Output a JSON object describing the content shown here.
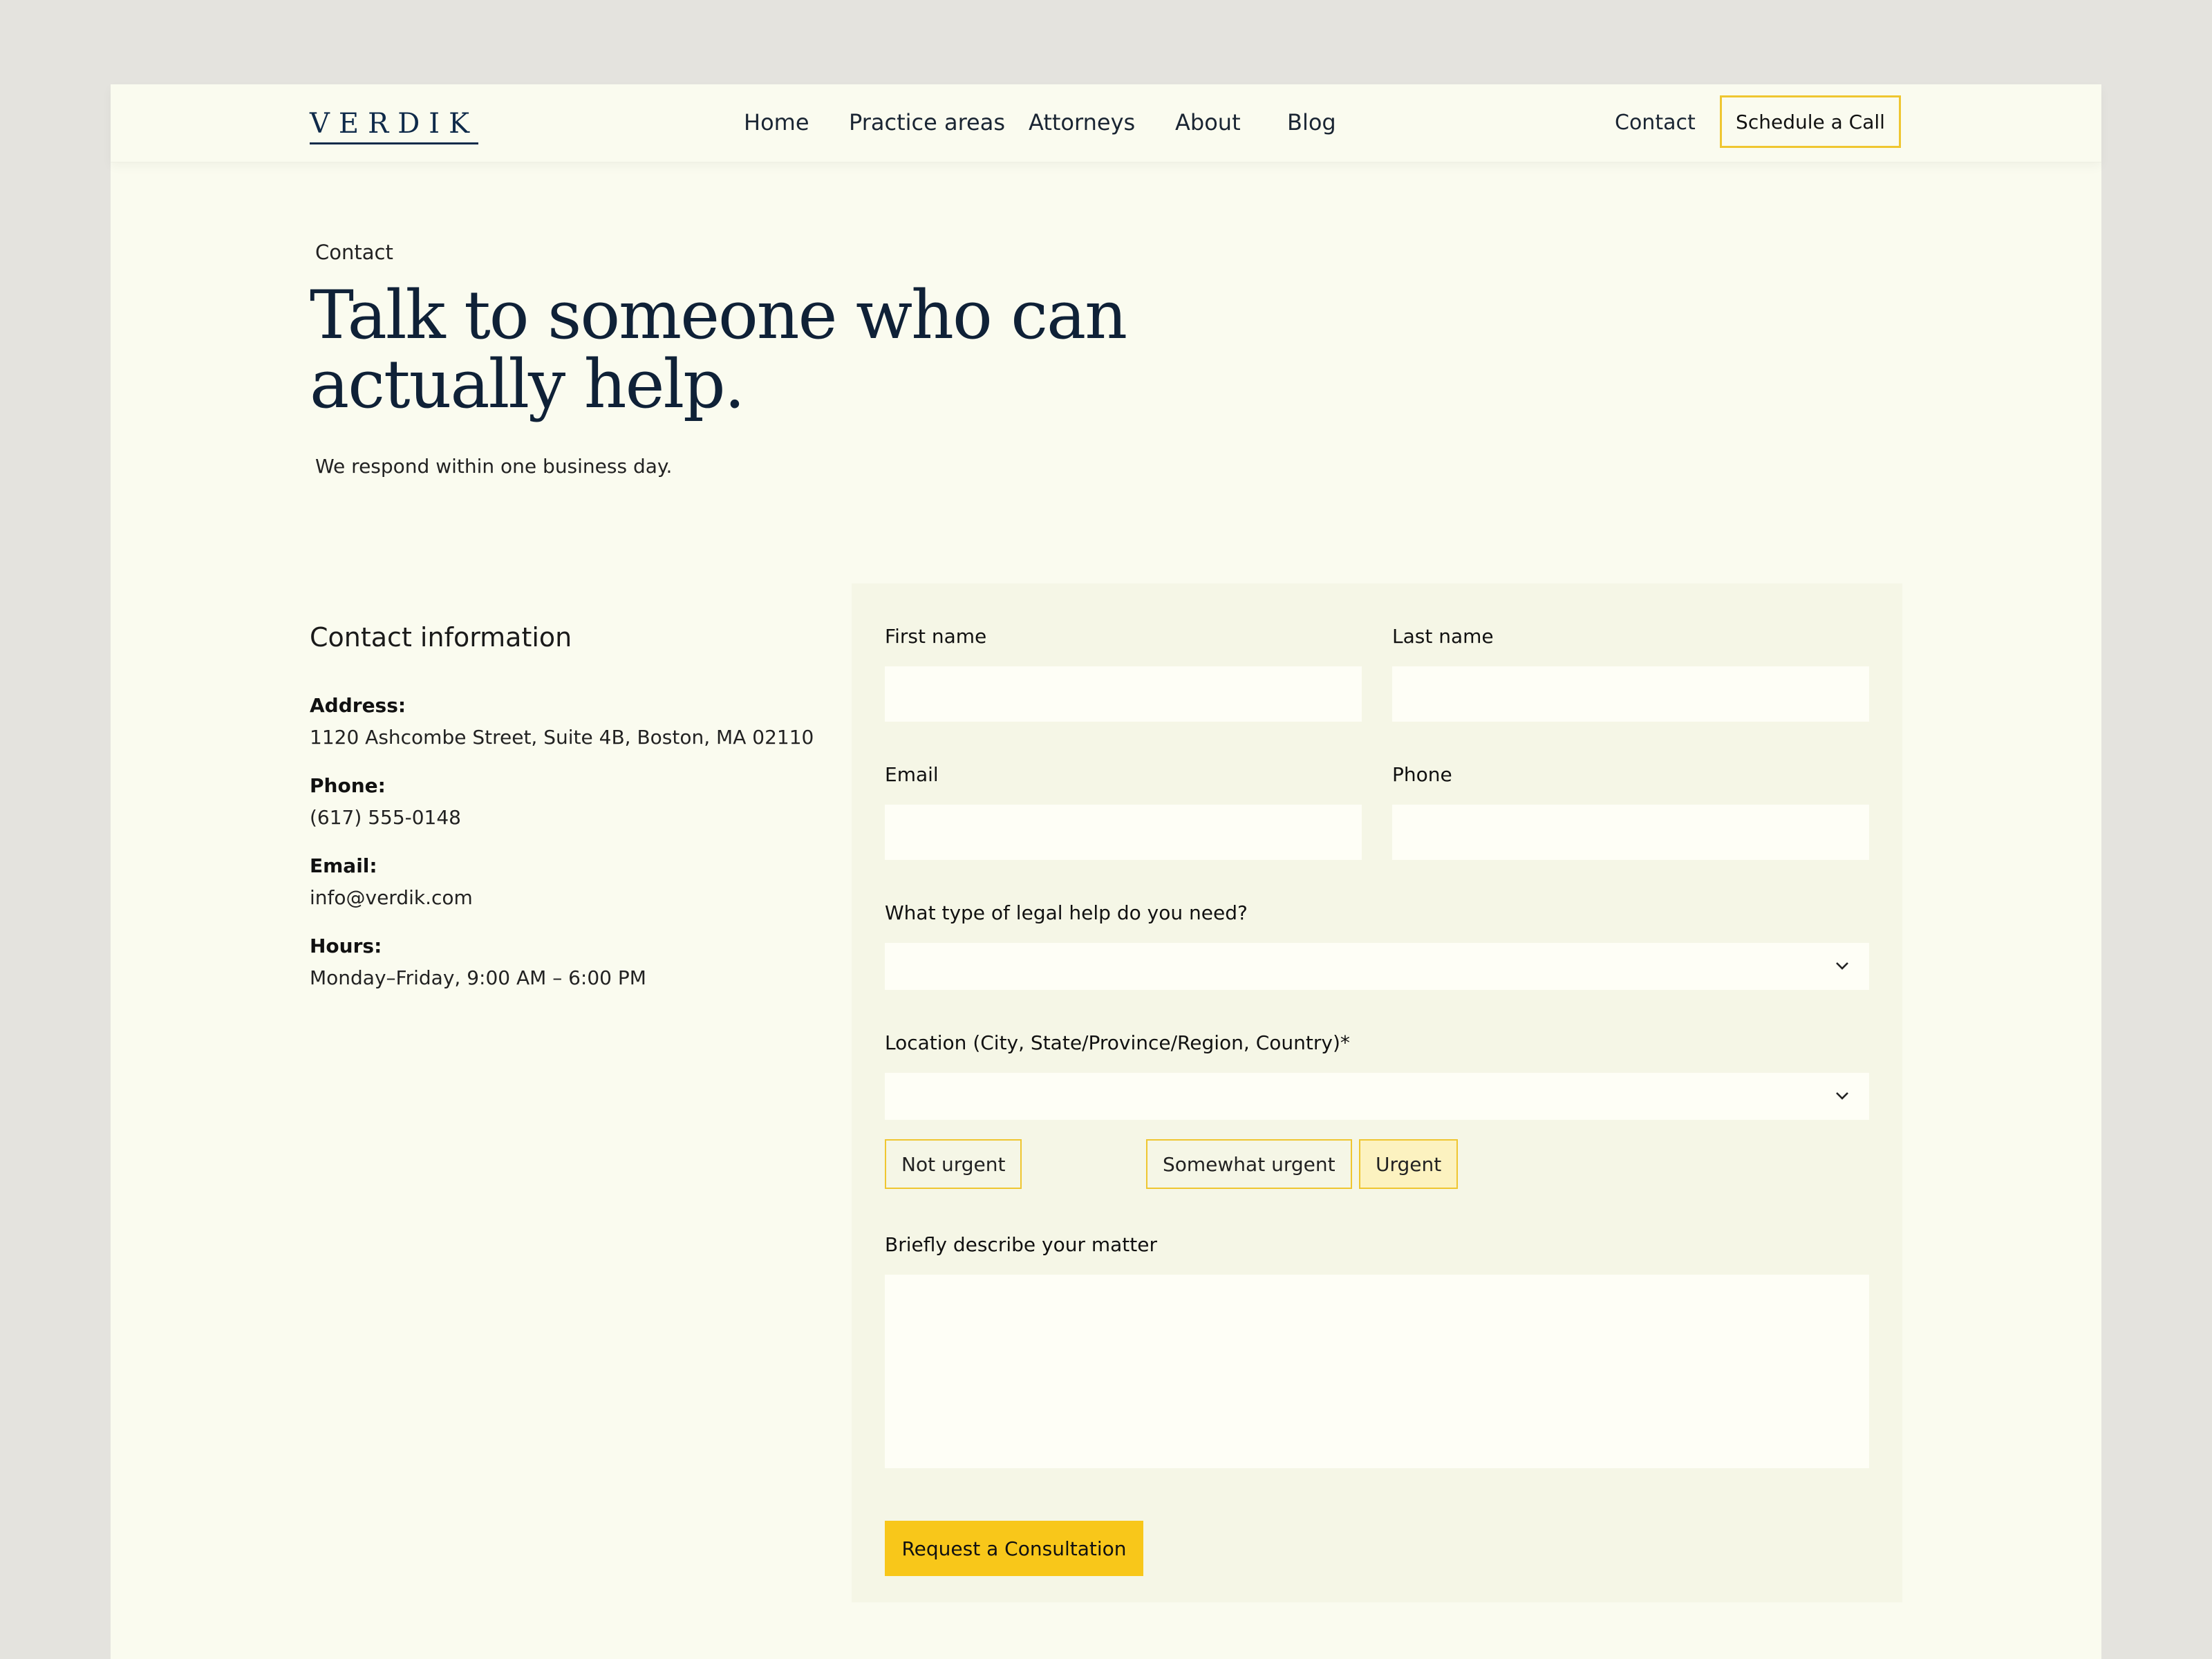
{
  "header": {
    "logo": "VERDIK",
    "nav": [
      "Home",
      "Practice areas",
      "Attorneys",
      "About",
      "Blog"
    ],
    "contact_link": "Contact",
    "schedule_button": "Schedule a Call"
  },
  "hero": {
    "breadcrumb": "Contact",
    "title": "Talk to someone who can actually help.",
    "subtitle": "We respond within one business day."
  },
  "contact_info": {
    "heading": "Contact information",
    "items": [
      {
        "label": "Address:",
        "value": "1120 Ashcombe Street, Suite 4B, Boston, MA 02110"
      },
      {
        "label": "Phone:",
        "value": "(617) 555-0148"
      },
      {
        "label": "Email:",
        "value": "info@verdik.com"
      },
      {
        "label": "Hours:",
        "value": "Monday–Friday, 9:00 AM – 6:00 PM"
      }
    ]
  },
  "form": {
    "first_name": {
      "label": "First name",
      "value": ""
    },
    "last_name": {
      "label": "Last name",
      "value": ""
    },
    "email": {
      "label": "Email",
      "value": ""
    },
    "phone": {
      "label": "Phone",
      "value": ""
    },
    "legal_help": {
      "label": "What type of legal help do you need?",
      "value": ""
    },
    "location": {
      "label": "Location (City, State/Province/Region, Country)*",
      "value": ""
    },
    "urgency": {
      "options": [
        "Not urgent",
        "Somewhat urgent",
        "Urgent"
      ],
      "selected": "Urgent"
    },
    "matter": {
      "label": "Briefly describe your matter",
      "value": ""
    },
    "submit_label": "Request a Consultation"
  },
  "colors": {
    "accent": "#f8c71a",
    "navy": "#0f2137",
    "page_bg": "#fafbef",
    "panel_bg": "#f5f6e6"
  }
}
